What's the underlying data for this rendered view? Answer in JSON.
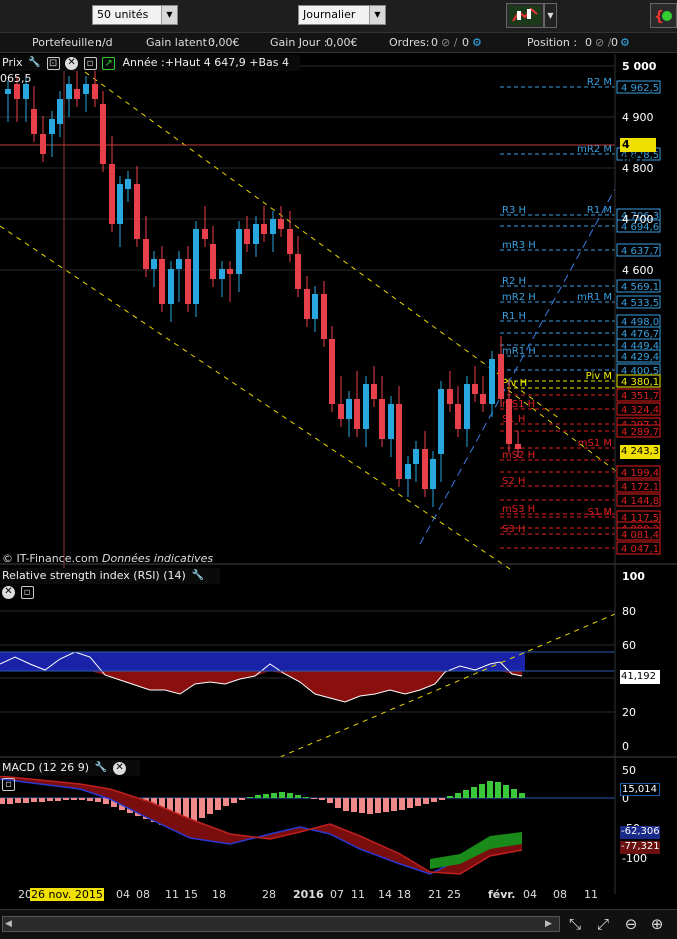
{
  "toolbar": {
    "quantity": "50 unités",
    "timeframe": "Journalier"
  },
  "info": {
    "portefeuille_label": "Portefeuille :",
    "portefeuille_value": "n/d",
    "gain_latent_label": "Gain latent :",
    "gain_latent_value": "0,00€",
    "gain_jour_label": "Gain Jour :",
    "gain_jour_value": "0,00€",
    "ordres_label": "Ordres:",
    "ordres_value": "0",
    "ordres_value2": "0",
    "position_label": "Position :",
    "position_value": "0",
    "position_value2": "0"
  },
  "price_panel": {
    "title": "Prix",
    "annee_text": "Année :+Haut 4 647,9 +Bas 4 065,5",
    "copyright": "© IT-Finance.com",
    "disclaimer": "Données indicatives",
    "current_price": "4 847",
    "last_price": "4 243,3",
    "axis_ticks": [
      "5 000",
      "4 900",
      "4 800",
      "4 700",
      "4 600"
    ]
  },
  "pivot_labels": [
    {
      "name": "R2 M",
      "value": "4 962,5"
    },
    {
      "name": "mR2 M",
      "value": "4 828,5"
    },
    {
      "name": "R3 H",
      "value": ""
    },
    {
      "name": "R1 M",
      "value": "4 706,3"
    },
    {
      "name": "",
      "value": "4 694,6"
    },
    {
      "name": "mR3 H",
      "value": "4 637,7"
    },
    {
      "name": "R2 H",
      "value": "4 569,1"
    },
    {
      "name": "mR2 H",
      "value": "4 533,5"
    },
    {
      "name": "mR1 M",
      "value": ""
    },
    {
      "name": "R1 H",
      "value": "4 498,0"
    },
    {
      "name": "",
      "value": "4 476,7"
    },
    {
      "name": "",
      "value": "4 449,4"
    },
    {
      "name": "mR1 H",
      "value": "4 429,4"
    },
    {
      "name": "",
      "value": "4 400,5"
    },
    {
      "name": "Piv M",
      "value": "4 380,1"
    },
    {
      "name": "Piv H",
      "value": ""
    },
    {
      "name": "",
      "value": "4 351,7"
    },
    {
      "name": "mS1 H",
      "value": "4 324,4"
    },
    {
      "name": "S1 H",
      "value": "4 297,1"
    },
    {
      "name": "",
      "value": "4 289,7"
    },
    {
      "name": "mS1 M",
      "value": ""
    },
    {
      "name": "mS2 H",
      "value": ""
    },
    {
      "name": "",
      "value": "4 199,4"
    },
    {
      "name": "S2 H",
      "value": "4 172,1"
    },
    {
      "name": "",
      "value": "4 144,8"
    },
    {
      "name": "mS3 H",
      "value": ""
    },
    {
      "name": "S1 M",
      "value": "4 117,5"
    },
    {
      "name": "",
      "value": "4 090,2"
    },
    {
      "name": "S3 H",
      "value": "4 081,4"
    },
    {
      "name": "",
      "value": "4 047,1"
    }
  ],
  "rsi_panel": {
    "title": "Relative strength index (RSI) (14)",
    "value": "41,192",
    "axis_ticks": [
      "100",
      "80",
      "60",
      "40",
      "20",
      "0"
    ]
  },
  "macd_panel": {
    "title": "MACD (12 26 9)",
    "value1": "15,014",
    "value2": "-62,306",
    "value3": "-77,321",
    "axis_ticks": [
      "50",
      "0",
      "-50",
      "-100"
    ]
  },
  "xaxis": {
    "highlight": "26 nov. 2015",
    "labels": [
      "20",
      "c.",
      "04",
      "08",
      "11",
      "15",
      "18",
      "28",
      "2016",
      "07",
      "11",
      "14",
      "18",
      "21",
      "25",
      "févr.",
      "04",
      "08",
      "11"
    ]
  },
  "colors": {
    "bull": "#29a8e0",
    "bear": "#e8404a",
    "pivot_blue": "#3aa0e0",
    "pivot_red": "#e02020",
    "pivot_yellow": "#f0f000",
    "rsi_fill_blue": "#1a22a8",
    "rsi_fill_red": "#8a1010"
  }
}
